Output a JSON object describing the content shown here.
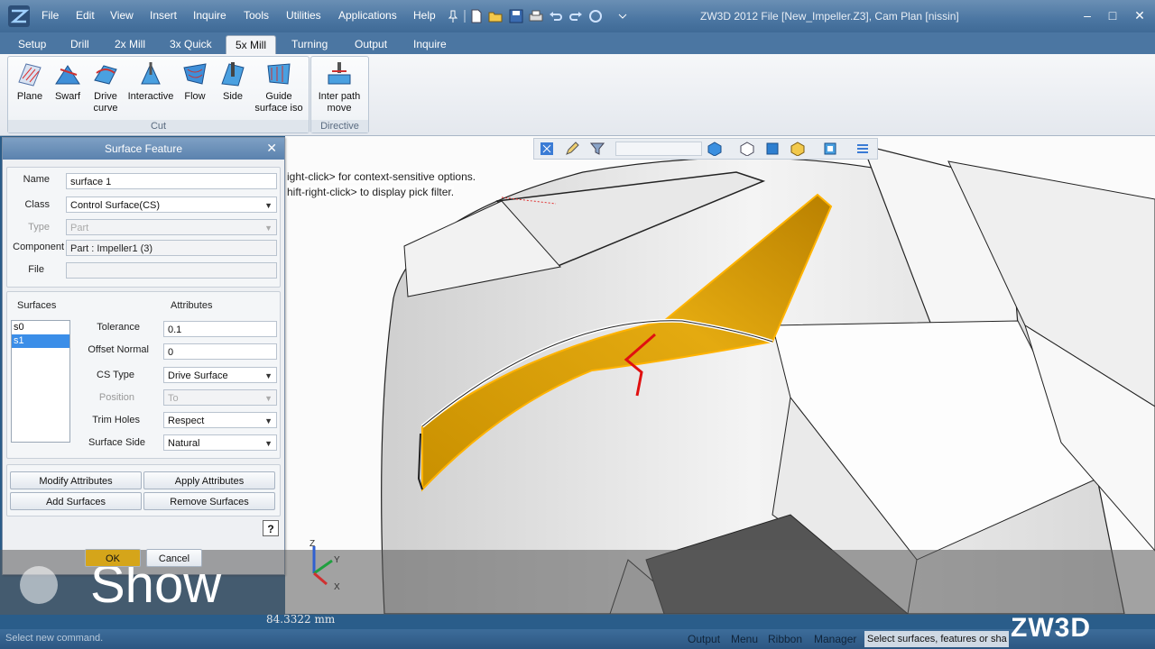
{
  "window": {
    "title": "ZW3D 2012        File [New_Impeller.Z3],  Cam Plan [nissin]"
  },
  "menu": [
    "File",
    "Edit",
    "View",
    "Insert",
    "Inquire",
    "Tools",
    "Utilities",
    "Applications",
    "Help"
  ],
  "tabs": [
    "Setup",
    "Drill",
    "2x Mill",
    "3x Quick",
    "5x Mill",
    "Turning",
    "Output",
    "Inquire"
  ],
  "active_tab": "5x Mill",
  "ribbon": {
    "cut_group_label": "Cut",
    "directive_group_label": "Directive",
    "buttons": {
      "plane": "Plane",
      "swarf": "Swarf",
      "drive_curve": [
        "Drive",
        "curve"
      ],
      "interactive": "Interactive",
      "flow": "Flow",
      "side": "Side",
      "guide": [
        "Guide",
        "surface iso"
      ],
      "inter_path": [
        "Inter path",
        "move"
      ]
    }
  },
  "viewport": {
    "hint_line1": "ight-click> for context-sensitive options.",
    "hint_line2": "hift-right-click> to display pick filter."
  },
  "dialog": {
    "title": "Surface Feature",
    "name_label": "Name",
    "name_value": "surface 1",
    "class_label": "Class",
    "class_value": "Control Surface(CS)",
    "type_label": "Type",
    "type_value": "Part",
    "component_label": "Component",
    "component_value": "Part : Impeller1 (3)",
    "file_label": "File",
    "file_value": "",
    "surfaces_label": "Surfaces",
    "attributes_label": "Attributes",
    "surfaces": [
      "s0",
      "s1"
    ],
    "selected_surface": "s1",
    "tolerance_label": "Tolerance",
    "tolerance_value": "0.1",
    "offset_label": "Offset Normal",
    "offset_value": "0",
    "cstype_label": "CS Type",
    "cstype_value": "Drive Surface",
    "position_label": "Position",
    "position_value": "To",
    "trim_label": "Trim Holes",
    "trim_value": "Respect",
    "side_label": "Surface Side",
    "side_value": "Natural",
    "btn_modify": "Modify Attributes",
    "btn_apply": "Apply Attributes",
    "btn_add": "Add Surfaces",
    "btn_remove": "Remove Surfaces",
    "help": "?",
    "ok": "OK",
    "cancel": "Cancel"
  },
  "overlay": {
    "show_text": "Show"
  },
  "axes": {
    "z": "Z",
    "y": "Y",
    "x": "X"
  },
  "coordinate_readout": "84.3322 mm",
  "status": {
    "message": "Select new command.",
    "tabs": [
      "Output",
      "Menu",
      "Ribbon",
      "Manager"
    ],
    "hint": "Select surfaces, features or sha"
  },
  "brand": "ZW3D",
  "colors": {
    "accent": "#4b76a2",
    "selection": "#3b8ee8",
    "surface_highlight": "#d9a400"
  }
}
